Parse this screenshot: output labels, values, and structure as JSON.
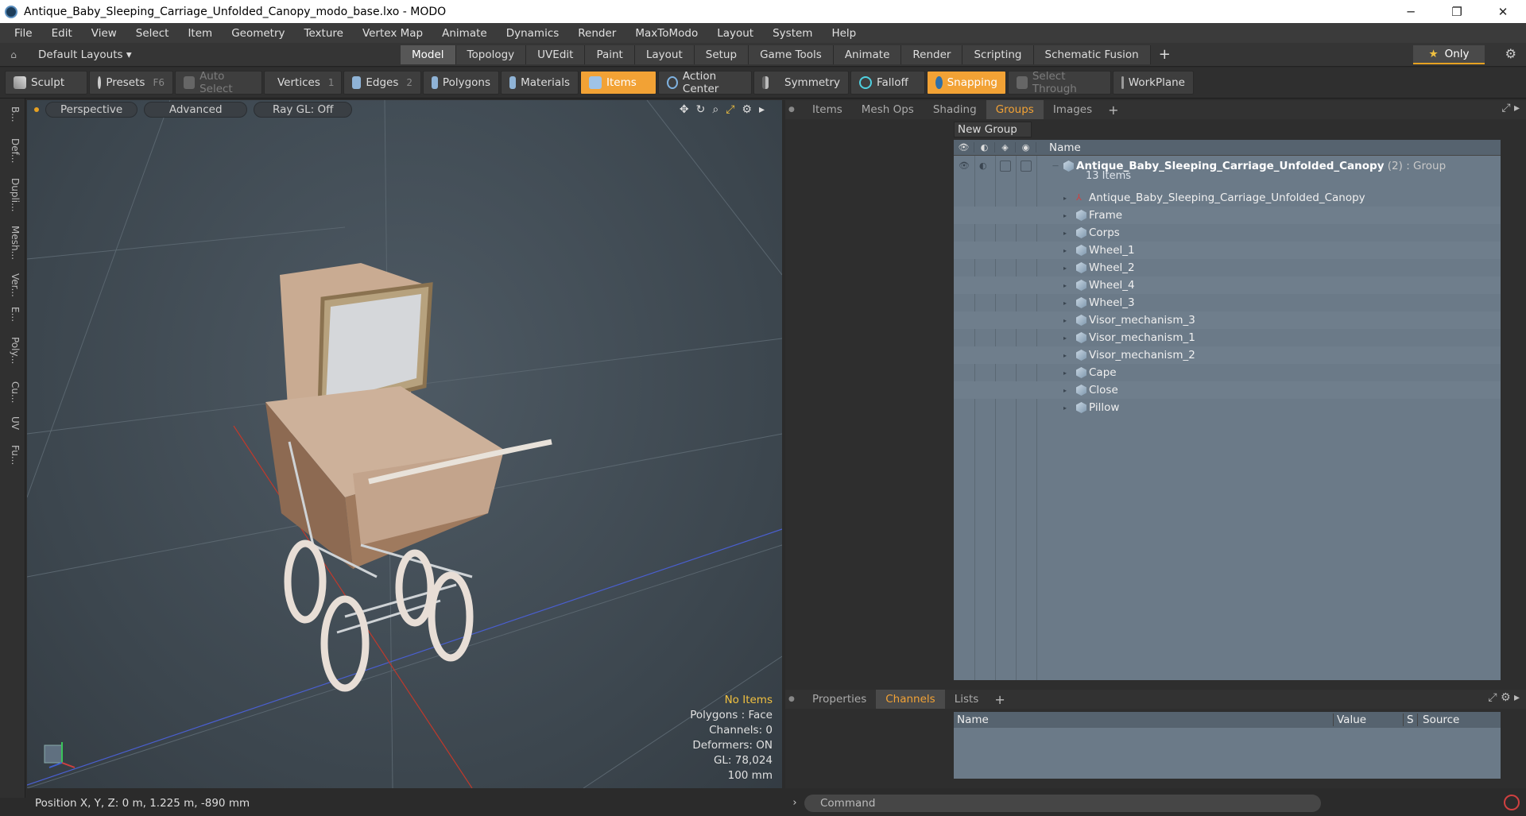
{
  "window": {
    "title": "Antique_Baby_Sleeping_Carriage_Unfolded_Canopy_modo_base.lxo - MODO",
    "minimize": "─",
    "restore": "❐",
    "close": "✕"
  },
  "menu": [
    "File",
    "Edit",
    "View",
    "Select",
    "Item",
    "Geometry",
    "Texture",
    "Vertex Map",
    "Animate",
    "Dynamics",
    "Render",
    "MaxToModo",
    "Layout",
    "System",
    "Help"
  ],
  "layout": {
    "default_layouts": "Default Layouts ▾",
    "tabs": [
      "Model",
      "Topology",
      "UVEdit",
      "Paint",
      "Layout",
      "Setup",
      "Game Tools",
      "Animate",
      "Render",
      "Scripting",
      "Schematic Fusion"
    ],
    "active_tab": "Model",
    "plus": "+",
    "only_label": "Only"
  },
  "toolbar": {
    "sculpt": "Sculpt",
    "presets": "Presets",
    "presets_key": "F6",
    "auto_select": "Auto Select",
    "vertices": "Vertices",
    "vertices_count": "1",
    "edges": "Edges",
    "edges_count": "2",
    "polygons": "Polygons",
    "materials": "Materials",
    "items": "Items",
    "action_center": "Action Center",
    "symmetry": "Symmetry",
    "falloff": "Falloff",
    "snapping": "Snapping",
    "select_through": "Select Through",
    "workplane": "WorkPlane"
  },
  "left_strip": [
    "B...",
    "Def...",
    "Dupli...",
    "Mesh...",
    "Ver...",
    "E...",
    "Poly...",
    "Cu...",
    "UV",
    "Fu..."
  ],
  "viewport": {
    "perspective": "Perspective",
    "advanced": "Advanced",
    "raygl": "Ray GL: Off",
    "info": {
      "no_items": "No Items",
      "polygons": "Polygons : Face",
      "channels": "Channels: 0",
      "deformers": "Deformers: ON",
      "gl": "GL: 78,024",
      "scale": "100 mm"
    }
  },
  "status": {
    "position": "Position X, Y, Z:   0 m, 1.225 m, -890 mm"
  },
  "groups_panel": {
    "tabs": [
      "Items",
      "Mesh Ops",
      "Shading",
      "Groups",
      "Images"
    ],
    "active_tab": "Groups",
    "new_group": "New Group",
    "name_header": "Name",
    "group_name": "Antique_Baby_Sleeping_Carriage_Unfolded_Canopy",
    "group_count": " (2) : Group",
    "group_sub": "13 Items",
    "items": [
      "Antique_Baby_Sleeping_Carriage_Unfolded_Canopy",
      "Frame",
      "Corps",
      "Wheel_1",
      "Wheel_2",
      "Wheel_4",
      "Wheel_3",
      "Visor_mechanism_3",
      "Visor_mechanism_1",
      "Visor_mechanism_2",
      "Cape",
      "Close",
      "Pillow"
    ]
  },
  "channels_panel": {
    "tabs": [
      "Properties",
      "Channels",
      "Lists"
    ],
    "active_tab": "Channels",
    "headers": [
      "Name",
      "Value",
      "S",
      "Source"
    ]
  },
  "command": {
    "placeholder": "Command"
  }
}
